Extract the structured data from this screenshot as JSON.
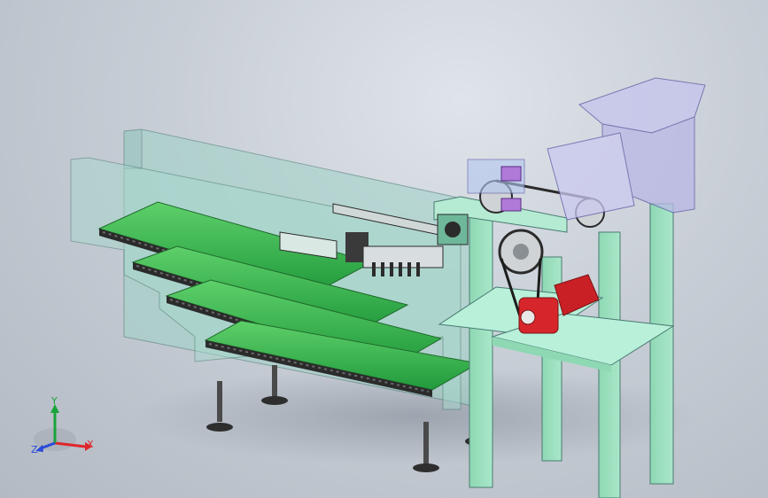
{
  "viewport": {
    "background_top": "#dfe4ea",
    "background_bottom": "#b3bac3"
  },
  "colors": {
    "housing": "#9fd3c7",
    "conveyor_belt": "#2fae4a",
    "frame": "#9fe0c0",
    "motor": "#d7262b",
    "hopper": "#b9b8e6",
    "block": "#b07ad8",
    "rail": "#2b2b2b"
  },
  "triad": {
    "x_label": "X",
    "y_label": "Y",
    "z_label": "Z",
    "x_color": "#e0262b",
    "y_color": "#1aa33a",
    "z_color": "#2a4ad8"
  },
  "model": {
    "conveyor_count": 4,
    "icons": [
      "conveyor-icon",
      "gear-icon",
      "motor-icon",
      "hopper-icon"
    ]
  }
}
